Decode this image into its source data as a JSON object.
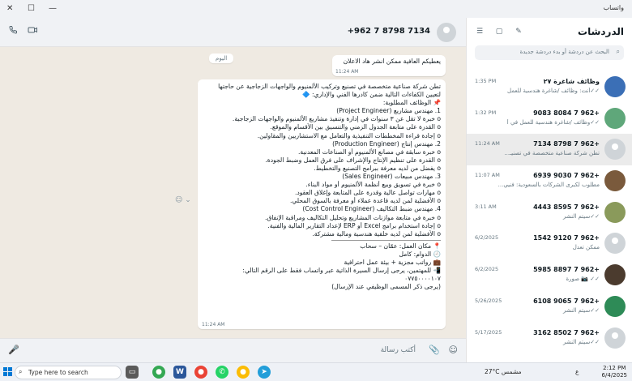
{
  "window": {
    "title": "واتساب"
  },
  "chat_header": {
    "contact_name": "+962 7 8798 7134"
  },
  "messages": {
    "day_chip": "اليوم",
    "msg1": {
      "text": "يعطيكم العافية ممكن انشر هاد الاعلان",
      "time": "11:24 AM"
    },
    "msg2": {
      "lines": [
        "تطن شركة صناعية متخصصة في تصنيع وتركيب الألمنيوم والواجهات الزجاجية عن حاجتها",
        "لتعيين الكفاءات التالية ضمن كادرها الفني والإداري: 🔷",
        "📌 الوظائف المطلوبة:",
        "1.        مهندس مشاريع (Project Engineer)",
        "o        خبرة لا تقل عن ٣ سنوات في إدارة وتنفيذ مشاريع الألمنيوم والواجهات الزجاجية.",
        "o        القدرة على متابعة الجدول الزمني والتنسيق بين الأقسام والموقع.",
        "o        إجادة قراءة المخططات التنفيذية والتعامل مع الاستشاريين والمقاولين.",
        "2.        مهندس إنتاج (Production Engineer)",
        "o        خبرة سابقة في مصانع الألمنيوم أو الصناعات المعدنية.",
        "o        القدرة على تنظيم الإنتاج والإشراف على فرق العمل وضبط الجودة.",
        "o        يفضل من لديه معرفة ببرامج التصنيع والتخطيط.",
        "3.        مهندس مبيعات (Sales Engineer)",
        "o        خبرة في تسويق وبيع أنظمة الألمنيوم أو مواد البناء.",
        "o        مهارات تواصل عالية وقدرة على المتابعة وإغلاق العقود.",
        "o        الأفضلية لمن لديه قاعدة عملاء أو معرفة بالسوق المحلي.",
        "4.        مهندس ضبط التكاليف (Cost Control Engineer)",
        "o        خبرة في متابعة موازنات المشاريع وتحليل التكاليف ومراقبة الإنفاق.",
        "o        إجادة استخدام برامج Excel أو ERP لإعداد التقارير المالية والفنية.",
        "o        الأفضلية لمن لديه خلفية هندسية ومالية مشتركة."
      ],
      "lines_after": [
        "📍 مكان العمل: عمّان – سحاب",
        "🕘 الدوام: كامل",
        "💼 رواتب مجزية + بيئة عمل احترافية",
        "📲 للمهتمين، يرجى إرسال السيرة الذاتية عبر واتساب فقط على الرقم التالي:",
        "٠٧٧٥٠٠٠٠١٠٧",
        "(يرجى ذكر المسمى الوظيفي عند الإرسال)"
      ],
      "time": "11:24 AM"
    }
  },
  "composer": {
    "placeholder": "أكتب رسالة"
  },
  "sidebar": {
    "title": "الدردشات",
    "search_placeholder": "البحث عن دردشة أو بدء دردشة جديدة",
    "chats": [
      {
        "name": "وظائف شاغرة ٢٧",
        "time": "1:35 PM",
        "preview": "✓✓أنت: وظائف /شاغرة هندسية للعمل",
        "avatar_color": "#3b6fb6"
      },
      {
        "name": "+962 7 8084 9083",
        "time": "1:32 PM",
        "preview": "✓✓وظائف /شاغرة هندسية للعمل في أ",
        "avatar_color": "#5fa77a"
      },
      {
        "name": "+962 7 8798 7134",
        "time": "11:24 AM",
        "preview": "تطن شركة صناعية متخصصة في تصنيـ...",
        "avatar_color": "#cfd4d8",
        "selected": true
      },
      {
        "name": "+962 7 9030 6939",
        "time": "11:07 AM",
        "preview": "مطلوب لكبرى الشركات بالسعودية: فنيي...",
        "avatar_color": "#7a5a3c"
      },
      {
        "name": "+962 7 8595 4443",
        "time": "3:11 AM",
        "preview": "✓✓سيتم النشر",
        "avatar_color": "#8a9a5b"
      },
      {
        "name": "+962 7 9120 1542",
        "time": "6/2/2025",
        "preview": "ممكن تعدل",
        "avatar_color": "#cfd4d8"
      },
      {
        "name": "+962 7 8897 5985",
        "time": "6/2/2025",
        "preview": "✓✓ 📷 صورة",
        "avatar_color": "#4b3b2e"
      },
      {
        "name": "+962 7 9065 6108",
        "time": "5/26/2025",
        "preview": "✓✓سيتم النشر",
        "avatar_color": "#2e8b57"
      },
      {
        "name": "+962 7 8502 3162",
        "time": "5/17/2025",
        "preview": "✓✓سيتم النشر",
        "avatar_color": "#cfd4d8"
      }
    ]
  },
  "taskbar": {
    "search_placeholder": "Type here to search",
    "weather": "27°C  مشمس",
    "lang": "ع",
    "time": "2:12 PM",
    "date": "6/4/2025"
  }
}
